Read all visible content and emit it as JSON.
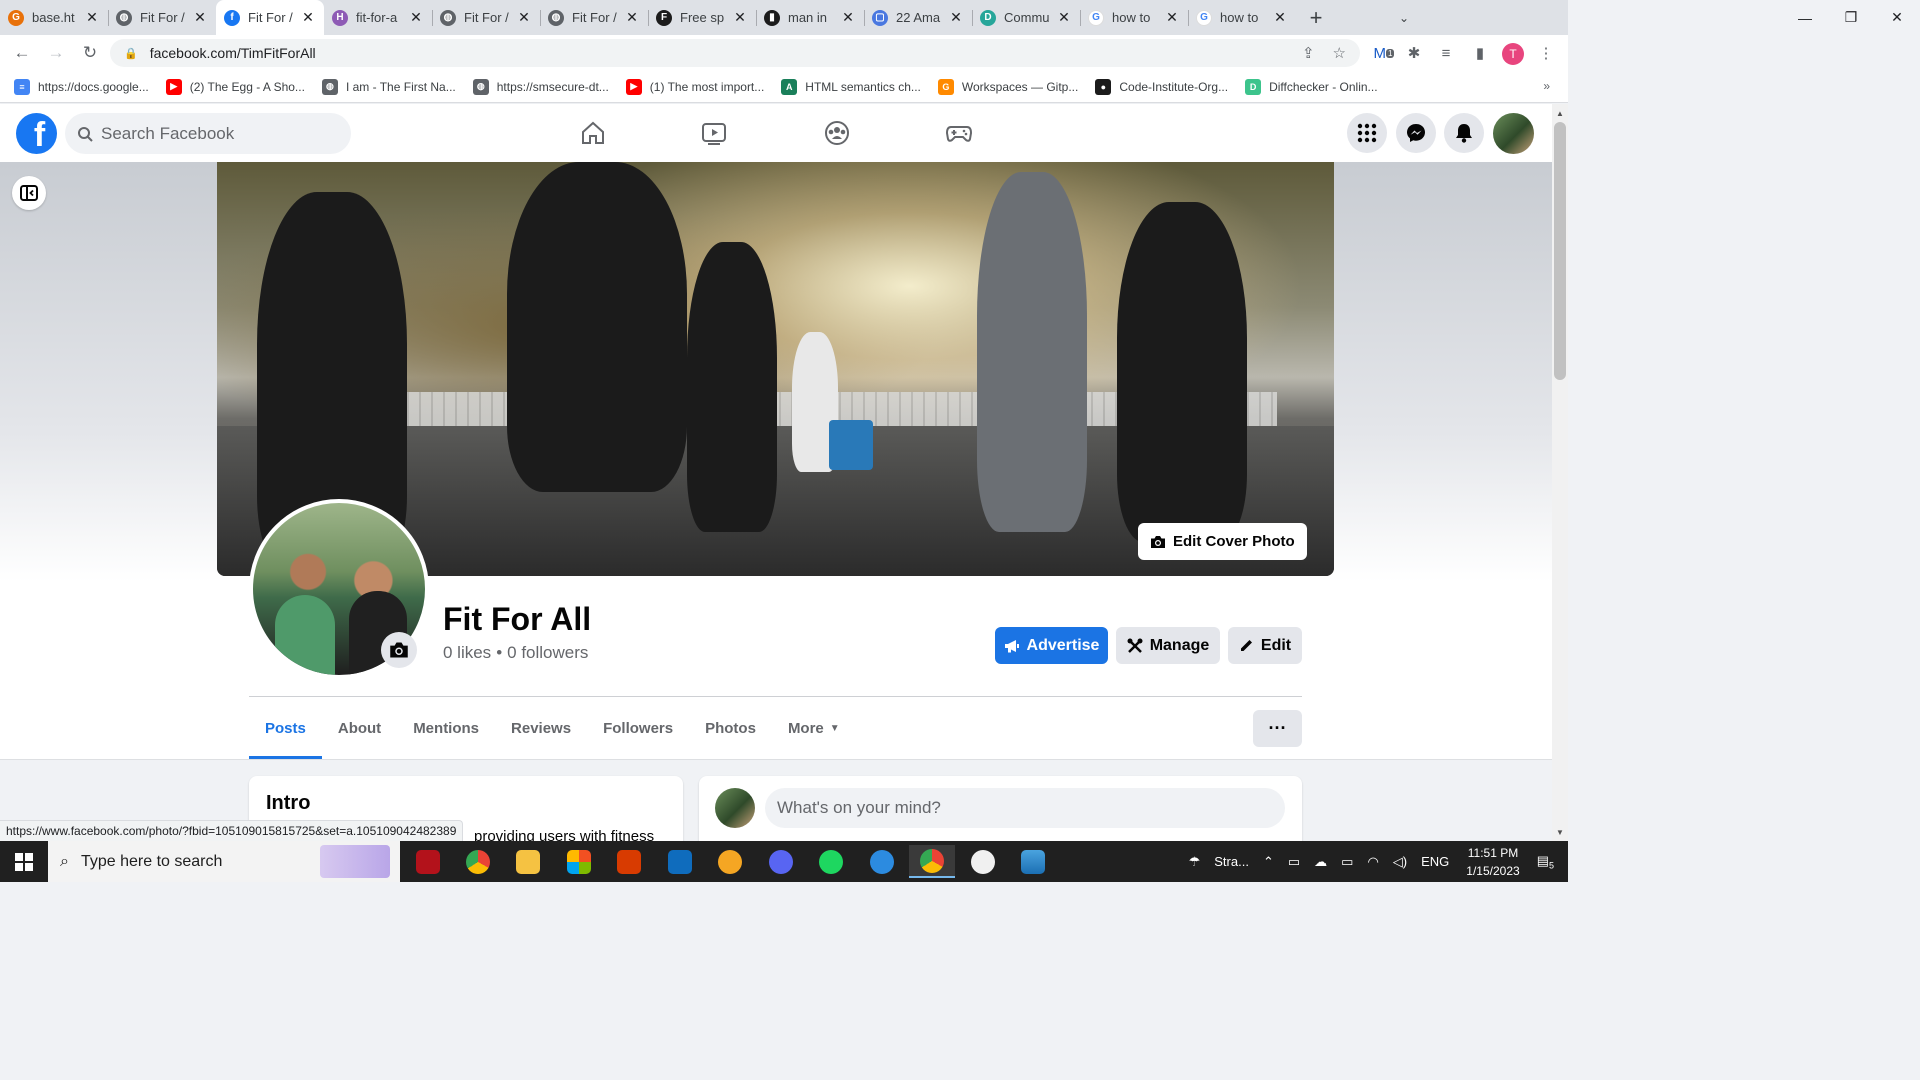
{
  "browser": {
    "tabs": [
      {
        "title": "base.ht",
        "color": "#e8710a",
        "letter": "G",
        "active": false
      },
      {
        "title": "Fit For /",
        "color": "#5f6368",
        "letter": "◍",
        "active": false
      },
      {
        "title": "Fit For /",
        "color": "#1877f2",
        "letter": "f",
        "active": true
      },
      {
        "title": "fit-for-a",
        "color": "#8e5bb5",
        "letter": "H",
        "active": false
      },
      {
        "title": "Fit For /",
        "color": "#5f6368",
        "letter": "◍",
        "active": false
      },
      {
        "title": "Fit For /",
        "color": "#5f6368",
        "letter": "◍",
        "active": false
      },
      {
        "title": "Free sp",
        "color": "#1c1c1c",
        "letter": "F",
        "active": false
      },
      {
        "title": "man in",
        "color": "#1c1c1c",
        "letter": "▮",
        "active": false
      },
      {
        "title": "22 Ama",
        "color": "#4a78e0",
        "letter": "▢",
        "active": false
      },
      {
        "title": "Commu",
        "color": "#27a69a",
        "letter": "D",
        "active": false
      },
      {
        "title": "how to",
        "color": "#ffffff",
        "letter": "G",
        "active": false
      },
      {
        "title": "how to",
        "color": "#ffffff",
        "letter": "G",
        "active": false
      }
    ],
    "url": "facebook.com/TimFitForAll",
    "profile_letter": "T",
    "ext_badge": "1",
    "bookmarks": [
      {
        "label": "https://docs.google...",
        "color": "#4285f4",
        "glyph": "≡"
      },
      {
        "label": "(2) The Egg - A Sho...",
        "color": "#ff0000",
        "glyph": "▶"
      },
      {
        "label": "I am - The First Na...",
        "color": "#5f6368",
        "glyph": "◍"
      },
      {
        "label": "https://smsecure-dt...",
        "color": "#5f6368",
        "glyph": "◍"
      },
      {
        "label": "(1) The most import...",
        "color": "#ff0000",
        "glyph": "▶"
      },
      {
        "label": "HTML semantics ch...",
        "color": "#1a7f5a",
        "glyph": "A"
      },
      {
        "label": "Workspaces — Gitp...",
        "color": "#ff8a00",
        "glyph": "G"
      },
      {
        "label": "Code-Institute-Org...",
        "color": "#1c1c1c",
        "glyph": "●"
      },
      {
        "label": "Diffchecker - Onlin...",
        "color": "#3cc48c",
        "glyph": "D"
      }
    ],
    "status_url": "https://www.facebook.com/photo/?fbid=105109015815725&set=a.105109042482389"
  },
  "facebook": {
    "search_placeholder": "Search Facebook",
    "page_name": "Fit For All",
    "likes": "0 likes",
    "followers": "0 followers",
    "edit_cover_label": "Edit Cover Photo",
    "advertise_label": "Advertise",
    "manage_label": "Manage",
    "edit_label": "Edit",
    "tabs": [
      "Posts",
      "About",
      "Mentions",
      "Reviews",
      "Followers",
      "Photos",
      "More"
    ],
    "active_tab": "Posts",
    "more_dots": "···",
    "intro_title": "Intro",
    "intro_text": "providing users with fitness",
    "composer_placeholder": "What's on your mind?",
    "accent": "#1b74e4"
  },
  "taskbar": {
    "search_placeholder": "Type here to search",
    "weather": "Stra...",
    "language": "ENG",
    "time": "11:51 PM",
    "date": "1/15/2023",
    "notifications": "5"
  }
}
